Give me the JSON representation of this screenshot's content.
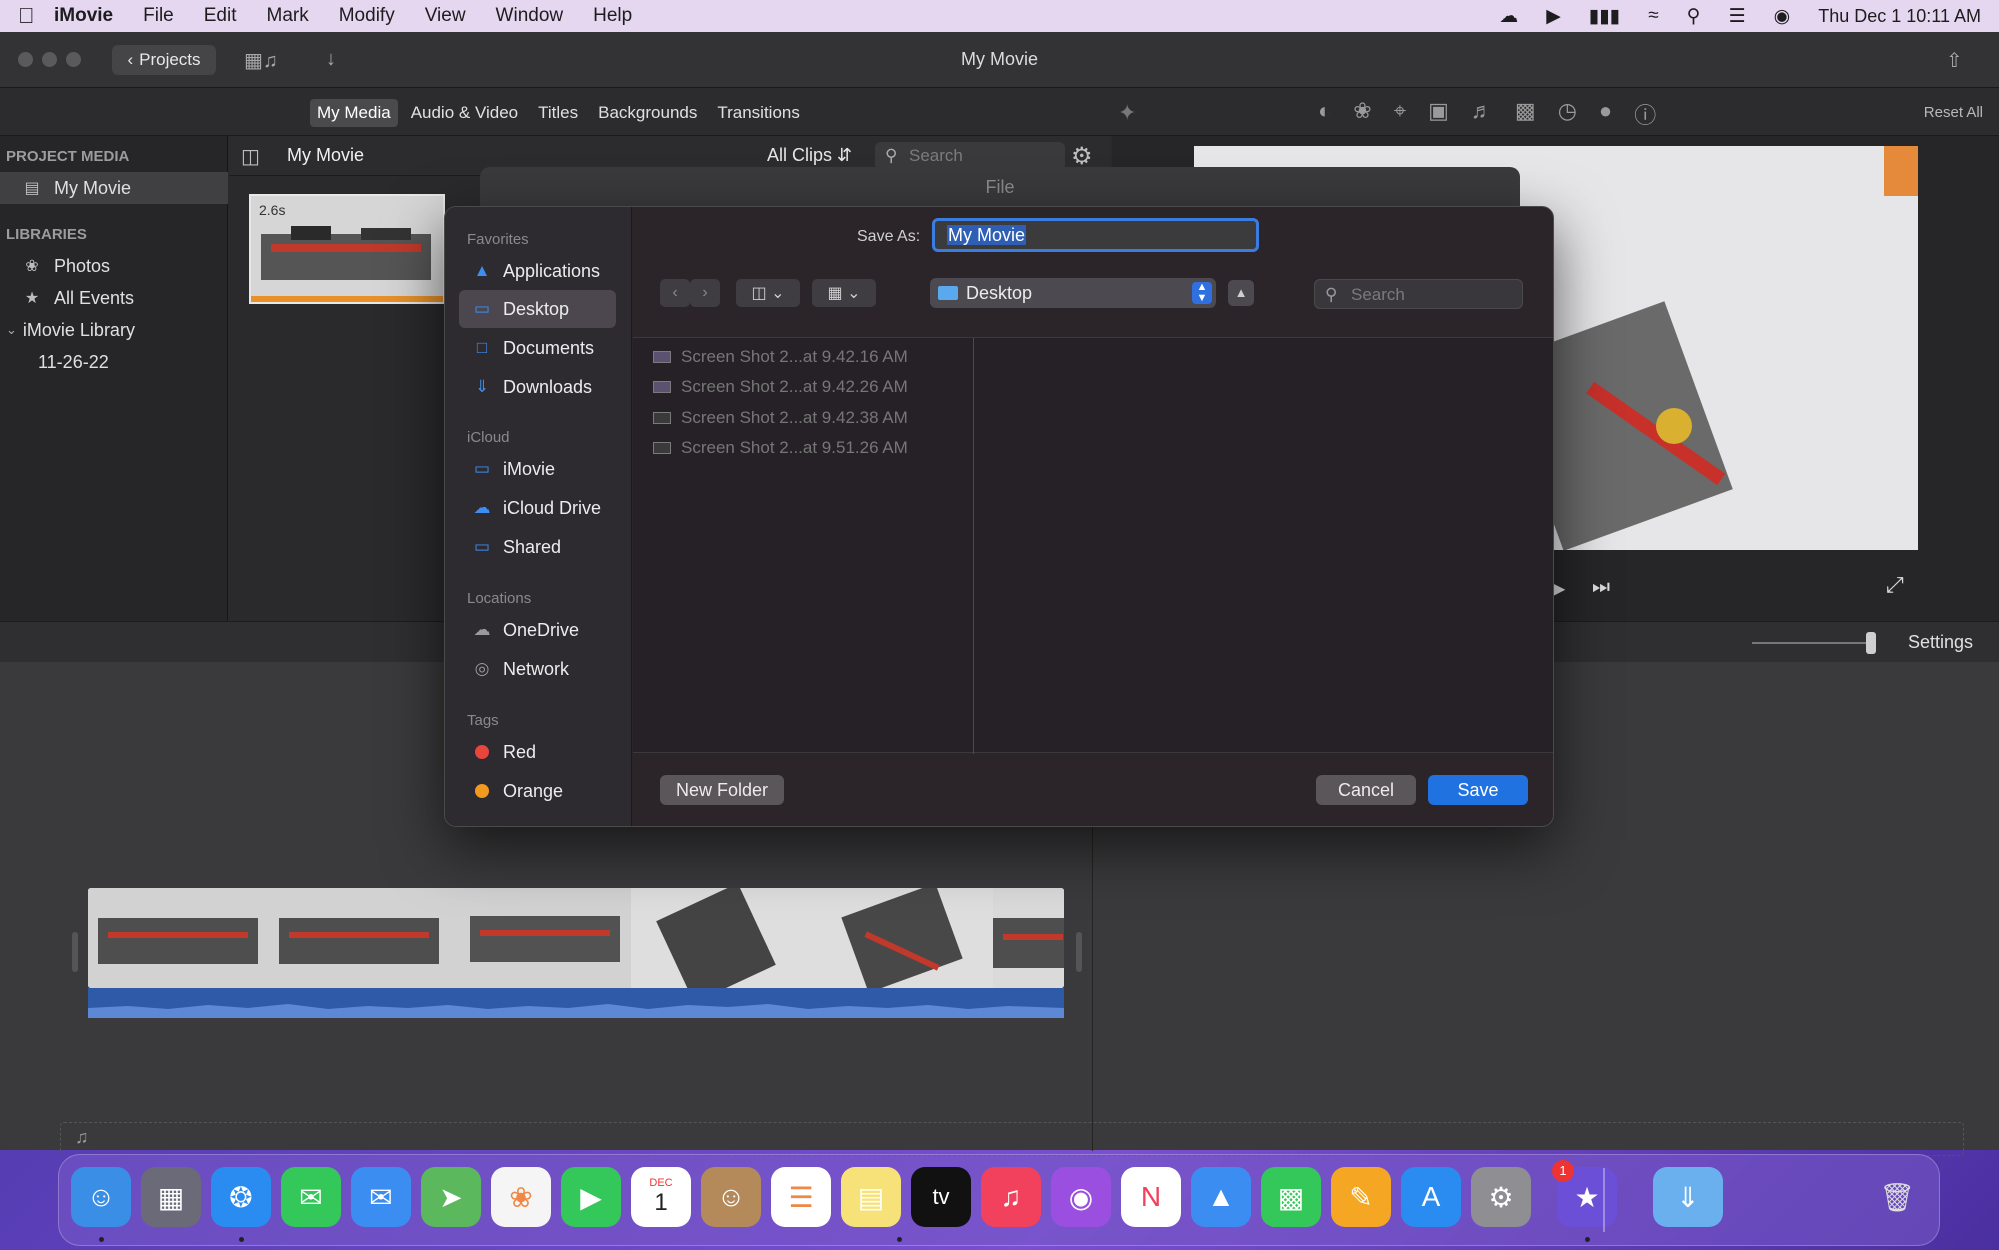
{
  "menubar": {
    "app_name": "iMovie",
    "items": [
      "File",
      "Edit",
      "Mark",
      "Modify",
      "View",
      "Window",
      "Help"
    ],
    "clock": "Thu Dec 1  10:11 AM"
  },
  "window": {
    "title": "My Movie",
    "projects_label": "Projects",
    "reset_all": "Reset All"
  },
  "media_tabs": [
    "My Media",
    "Audio & Video",
    "Titles",
    "Backgrounds",
    "Transitions"
  ],
  "sidebar": {
    "project_media_heading": "PROJECT MEDIA",
    "project_item": "My Movie",
    "libraries_heading": "LIBRARIES",
    "libraries": [
      "Photos",
      "All Events",
      "iMovie Library",
      "11-26-22"
    ]
  },
  "browser": {
    "title": "My Movie",
    "filter": "All Clips",
    "search_placeholder": "Search",
    "clip_duration": "2.6s"
  },
  "timeline": {
    "settings_label": "Settings"
  },
  "dialog": {
    "sheet_title": "File",
    "save_as_label": "Save As:",
    "save_as_value": "My Movie",
    "location": "Desktop",
    "search_placeholder": "Search",
    "favorites_heading": "Favorites",
    "favorites": [
      "Applications",
      "Desktop",
      "Documents",
      "Downloads"
    ],
    "icloud_heading": "iCloud",
    "icloud": [
      "iMovie",
      "iCloud Drive",
      "Shared"
    ],
    "locations_heading": "Locations",
    "locations": [
      "OneDrive",
      "Network"
    ],
    "tags_heading": "Tags",
    "tags": [
      {
        "name": "Red",
        "color": "#e8453c"
      },
      {
        "name": "Orange",
        "color": "#f29a1f"
      }
    ],
    "files": [
      "Screen Shot 2...at 9.42.16 AM",
      "Screen Shot 2...at 9.42.26 AM",
      "Screen Shot 2...at 9.42.38 AM",
      "Screen Shot 2...at 9.51.26 AM"
    ],
    "new_folder": "New Folder",
    "cancel": "Cancel",
    "save": "Save"
  },
  "dock": {
    "calendar_month": "DEC",
    "calendar_day": "1",
    "settings_badge": "1"
  }
}
